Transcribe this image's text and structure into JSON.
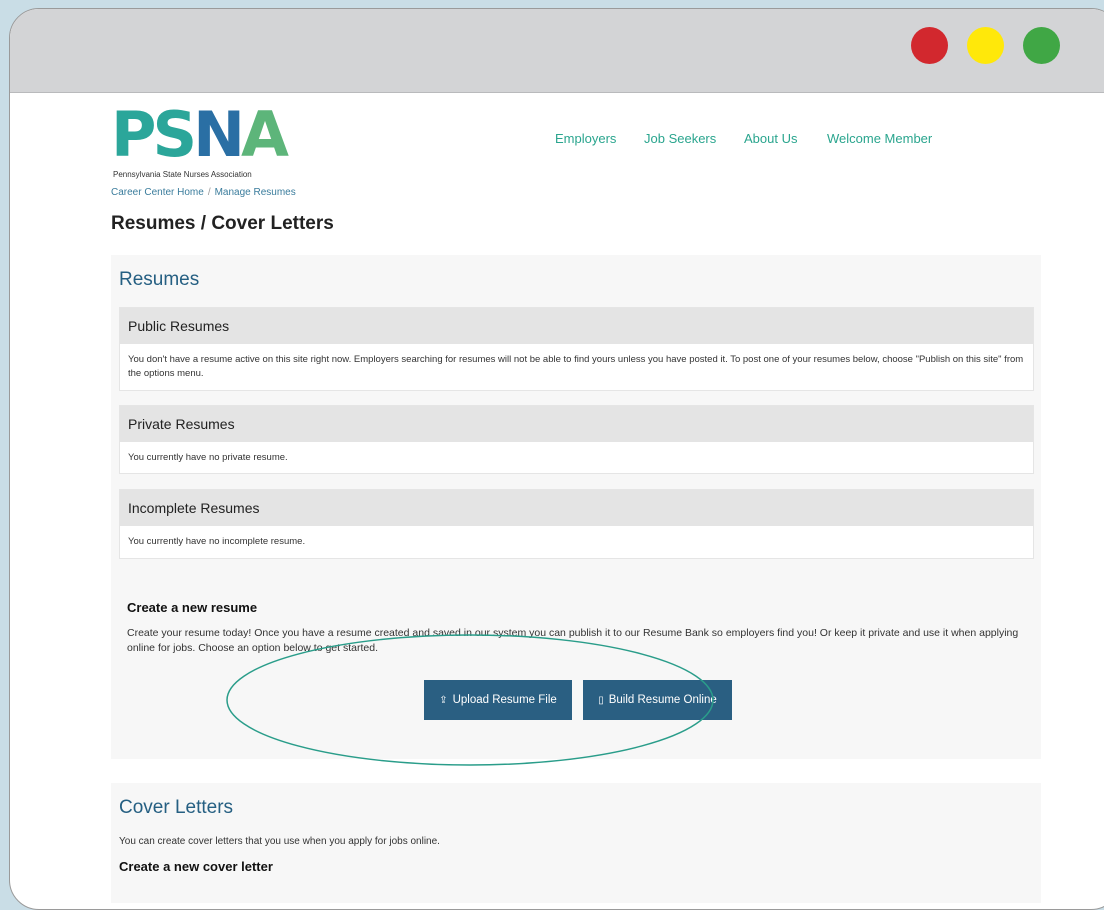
{
  "colors": {
    "background": "#c9dde6",
    "titlebar": "#d3d4d6",
    "nav_link": "#2aa58e",
    "heading_blue": "#255f82",
    "button": "#2a5f82",
    "traffic_red": "#d2282e",
    "traffic_yellow": "#ffe80a",
    "traffic_green": "#40a745",
    "highlight": "#2a9d8a"
  },
  "logo": {
    "letters": [
      "P",
      "S",
      "N",
      "A"
    ],
    "subtitle": "Pennsylvania State Nurses Association"
  },
  "nav": {
    "employers": "Employers",
    "job_seekers": "Job Seekers",
    "about_us": "About Us",
    "welcome_member": "Welcome Member"
  },
  "breadcrumb": {
    "home": "Career Center Home",
    "separator": "/",
    "current": "Manage Resumes"
  },
  "page": {
    "title": "Resumes / Cover Letters"
  },
  "resumes": {
    "title": "Resumes",
    "public": {
      "header": "Public Resumes",
      "body": "You don't have a resume active on this site right now. Employers searching for resumes will not be able to find yours unless you have posted it. To post one of your resumes below, choose \"Publish on this site\" from the options menu."
    },
    "private": {
      "header": "Private Resumes",
      "body": "You currently have no private resume."
    },
    "incomplete": {
      "header": "Incomplete Resumes",
      "body": "You currently have no incomplete resume."
    },
    "create": {
      "title": "Create a new resume",
      "text": "Create your resume today! Once you have a resume created and saved in our system you can publish it to our Resume Bank so employers find you! Or keep it private and use it when applying online for jobs. Choose an option below to get started.",
      "upload_label": "Upload Resume File",
      "build_label": "Build Resume Online",
      "upload_icon": "upload-icon",
      "build_icon": "build-icon"
    }
  },
  "cover_letters": {
    "title": "Cover Letters",
    "text": "You can create cover letters that you use when you apply for jobs online.",
    "sub_heading": "Create a new cover letter"
  }
}
